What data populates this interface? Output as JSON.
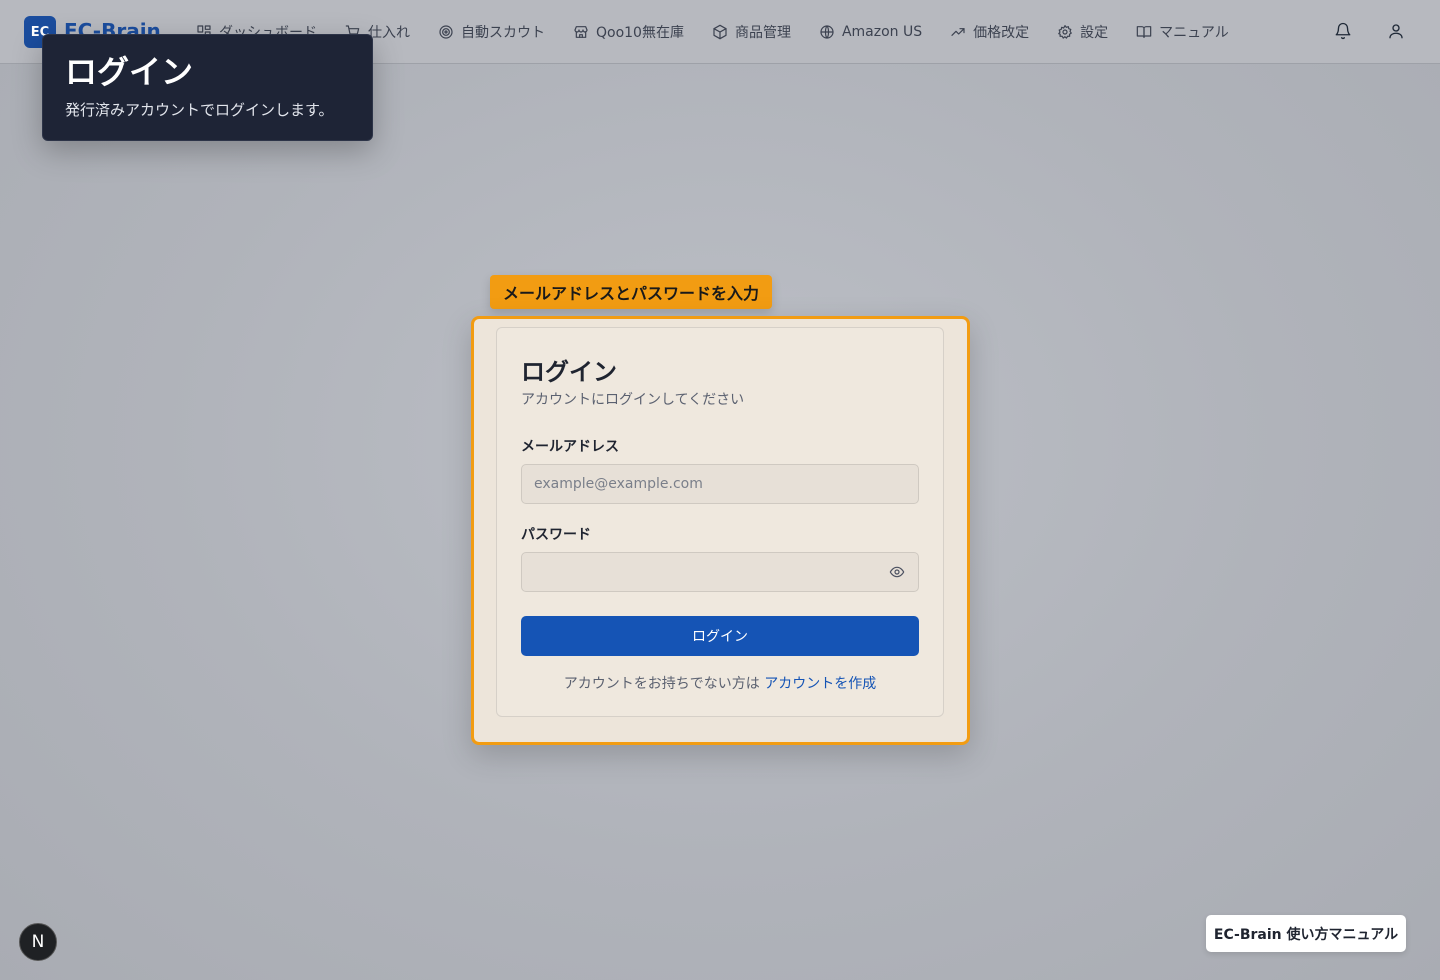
{
  "app": {
    "logo_abbr": "EC",
    "logo_name": "EC-Brain"
  },
  "nav": {
    "items": [
      {
        "label": "ダッシュボード",
        "icon": "dashboard-grid-icon"
      },
      {
        "label": "仕入れ",
        "icon": "cart-icon"
      },
      {
        "label": "自動スカウト",
        "icon": "target-icon"
      },
      {
        "label": "Qoo10無在庫",
        "icon": "store-icon"
      },
      {
        "label": "商品管理",
        "icon": "box-icon"
      },
      {
        "label": "Amazon US",
        "icon": "globe-icon"
      },
      {
        "label": "価格改定",
        "icon": "trending-up-icon"
      },
      {
        "label": "設定",
        "icon": "gear-icon"
      },
      {
        "label": "マニュアル",
        "icon": "book-icon"
      }
    ],
    "right_icons": [
      "bell-icon",
      "user-icon"
    ]
  },
  "guide_tooltip": {
    "title": "ログイン",
    "description": "発行済みアカウントでログインします。"
  },
  "highlight": {
    "label": "メールアドレスとパスワードを入力",
    "color": "#f29c12"
  },
  "login_card": {
    "title": "ログイン",
    "subtitle": "アカウントにログインしてください",
    "email_label": "メールアドレス",
    "email_placeholder": "example@example.com",
    "email_value": "",
    "password_label": "パスワード",
    "password_value": "",
    "submit_label": "ログイン",
    "signup_prompt": "アカウントをお持ちでない方は",
    "signup_link": "アカウントを作成"
  },
  "footer": {
    "dev_badge": "N",
    "manual_badge": "EC-Brain 使い方マニュアル"
  },
  "colors": {
    "primary": "#1554b5",
    "brand": "#1b4d9e",
    "tooltip_bg": "#1e2436"
  }
}
